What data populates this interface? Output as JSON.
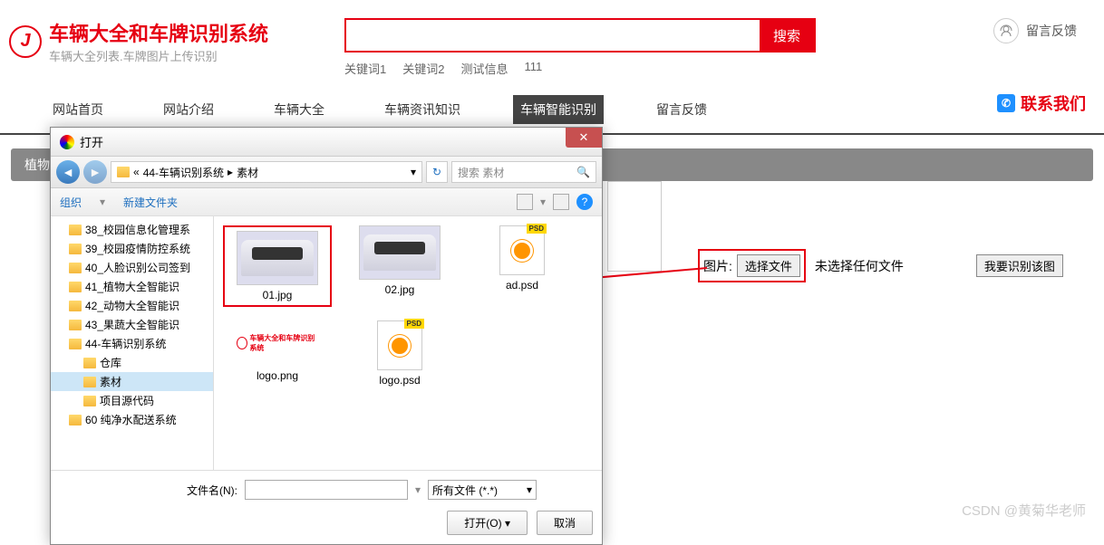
{
  "header": {
    "title": "车辆大全和车牌识别系统",
    "subtitle": "车辆大全列表.车牌图片上传识别",
    "search_btn": "搜索",
    "keywords": [
      "关键词1",
      "关键词2",
      "测试信息",
      "111"
    ],
    "feedback": "留言反馈"
  },
  "nav": {
    "items": [
      "网站首页",
      "网站介绍",
      "车辆大全",
      "车辆资讯知识",
      "车辆智能识别",
      "留言反馈"
    ],
    "contact": "联系我们"
  },
  "breadcrumb": "植物智能识别",
  "upload": {
    "label": "图片:",
    "choose_btn": "选择文件",
    "no_file": "未选择任何文件",
    "recognize_btn": "我要识别该图"
  },
  "dialog": {
    "title": "打开",
    "path_prefix": "«",
    "path_parts": [
      "44-车辆识别系统",
      "素材"
    ],
    "search_placeholder": "搜索 素材",
    "organize": "组织",
    "new_folder": "新建文件夹",
    "tree": [
      {
        "name": "38_校园信息化管理系",
        "indent": false
      },
      {
        "name": "39_校园疫情防控系统",
        "indent": false
      },
      {
        "name": "40_人脸识别公司签到",
        "indent": false
      },
      {
        "name": "41_植物大全智能识",
        "indent": false
      },
      {
        "name": "42_动物大全智能识",
        "indent": false
      },
      {
        "name": "43_果蔬大全智能识",
        "indent": false
      },
      {
        "name": "44-车辆识别系统",
        "indent": false
      },
      {
        "name": "仓库",
        "indent": true
      },
      {
        "name": "素材",
        "indent": true,
        "selected": true
      },
      {
        "name": "项目源代码",
        "indent": true
      },
      {
        "name": "60 纯净水配送系统",
        "indent": false
      }
    ],
    "files": [
      {
        "name": "01.jpg",
        "type": "car",
        "highlighted": true
      },
      {
        "name": "02.jpg",
        "type": "car"
      },
      {
        "name": "ad.psd",
        "type": "psd"
      },
      {
        "name": "logo.png",
        "type": "logo"
      },
      {
        "name": "logo.psd",
        "type": "psd"
      }
    ],
    "filename_label": "文件名(N):",
    "filetype": "所有文件 (*.*)",
    "open_btn": "打开(O)",
    "cancel_btn": "取消"
  },
  "watermark": "CSDN @黄菊华老师"
}
